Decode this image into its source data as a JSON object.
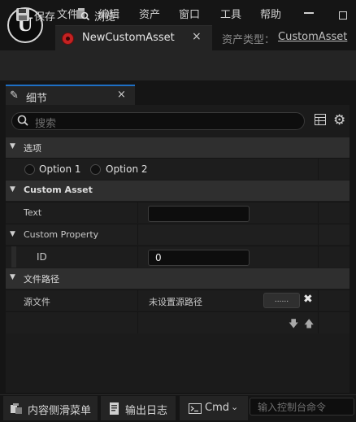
{
  "menu": [
    "文件",
    "编辑",
    "资产",
    "窗口",
    "工具",
    "帮助"
  ],
  "asset_tab": {
    "label": "NewCustomAsset",
    "close": "×"
  },
  "asset_type": {
    "label": "资产类型：",
    "value": "CustomAsset"
  },
  "toolbar": {
    "save_label": "保存",
    "browse_label": "浏览"
  },
  "details": {
    "tab_label": "细节",
    "tab_close": "×",
    "search_placeholder": "搜索",
    "categories": [
      {
        "label": "选项"
      },
      {
        "label": "Custom Asset"
      },
      {
        "label": "文件路径"
      }
    ],
    "options": [
      {
        "label": "Option 1"
      },
      {
        "label": "Option 2"
      }
    ],
    "properties": {
      "text": {
        "name": "Text",
        "value": ""
      },
      "custom_property": {
        "name": "Custom Property"
      },
      "id": {
        "name": "ID",
        "value": "0"
      },
      "source_file": {
        "name": "源文件",
        "value": "未设置源路径",
        "browse_button": "......"
      }
    }
  },
  "bottom_bar": {
    "content_drawer": "内容侧滑菜单",
    "output_log": "输出日志",
    "cmd": "Cmd",
    "console_placeholder": "输入控制台命令"
  },
  "colors": {
    "accent": "#1e6fc4",
    "asset_icon": "#c42222"
  }
}
